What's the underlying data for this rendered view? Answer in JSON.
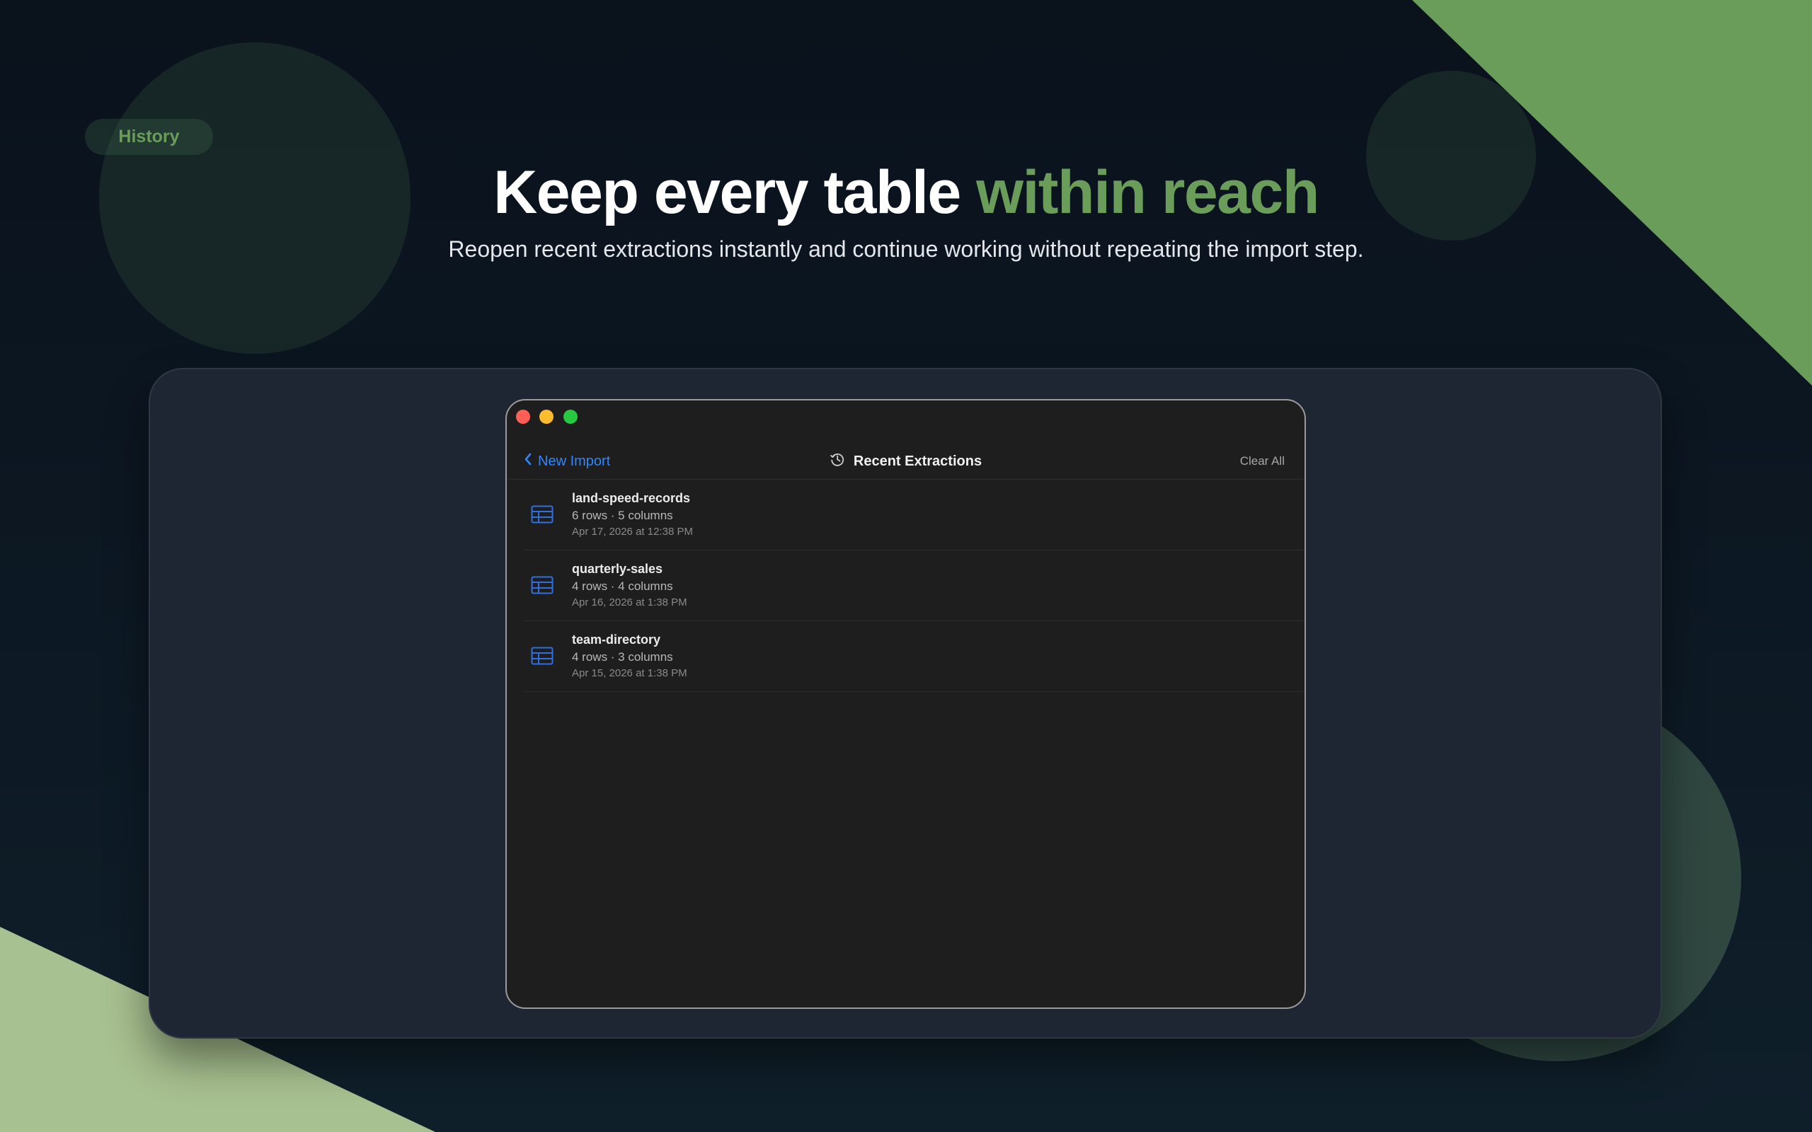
{
  "badge": {
    "label": "History"
  },
  "hero": {
    "title_main": "Keep every table ",
    "title_accent": "within reach",
    "subtitle": "Reopen recent extractions instantly and continue working without repeating the import step."
  },
  "colors": {
    "accent_green": "#6a9c5a",
    "link_blue": "#2f86ff",
    "traffic_red": "#ff5f57",
    "traffic_yellow": "#febc2e",
    "traffic_green": "#28c840"
  },
  "window": {
    "toolbar": {
      "back_label": "New Import",
      "back_icon": "chevron-left-icon",
      "title": "Recent Extractions",
      "title_icon": "history-clock-icon",
      "clear_label": "Clear All"
    },
    "items": [
      {
        "name": "land-speed-records",
        "meta": "6 rows · 5 columns",
        "date": "Apr 17, 2026 at 12:38 PM",
        "icon": "table-icon"
      },
      {
        "name": "quarterly-sales",
        "meta": "4 rows · 4 columns",
        "date": "Apr 16, 2026 at 1:38 PM",
        "icon": "table-icon"
      },
      {
        "name": "team-directory",
        "meta": "4 rows · 3 columns",
        "date": "Apr 15, 2026 at 1:38 PM",
        "icon": "table-icon"
      }
    ]
  }
}
